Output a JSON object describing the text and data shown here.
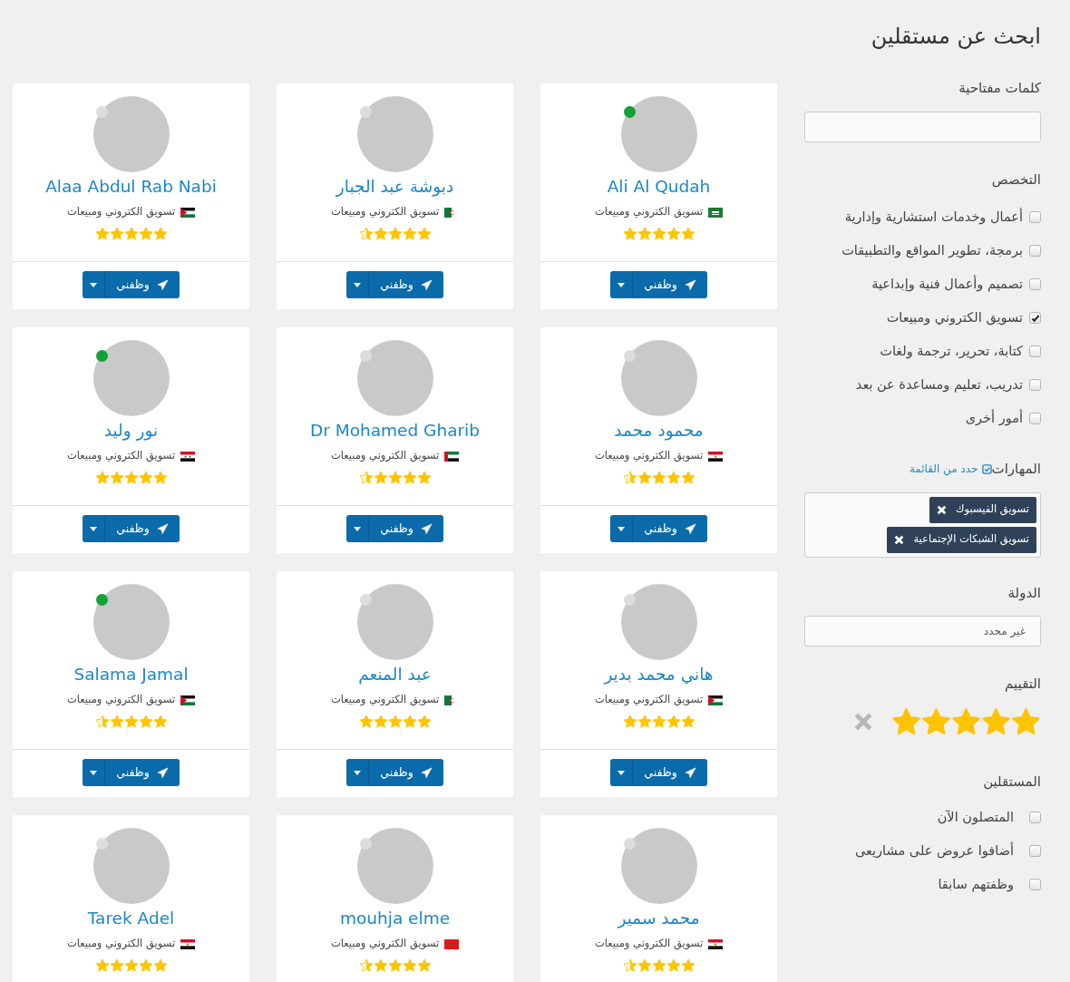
{
  "sidebar": {
    "title": "ابحث عن مستقلين",
    "keywords": {
      "label": "كلمات مفتاحية"
    },
    "specialty": {
      "label": "التخصص",
      "options": [
        {
          "label": "أعمال وخدمات استشارية وإدارية",
          "checked": false
        },
        {
          "label": "برمجة، تطوير المواقع والتطبيقات",
          "checked": false
        },
        {
          "label": "تصميم وأعمال فنية وإبداعية",
          "checked": false
        },
        {
          "label": "تسويق الكتروني ومبيعات",
          "checked": true
        },
        {
          "label": "كتابة، تحرير، ترجمة ولغات",
          "checked": false
        },
        {
          "label": "تدريب، تعليم ومساعدة عن بعد",
          "checked": false
        },
        {
          "label": "أمور أخرى",
          "checked": false
        }
      ]
    },
    "skills": {
      "label": "المهارات",
      "pick_link": "حدد من القائمة",
      "tags": [
        "تسويق الفيسبوك",
        "تسويق الشبكات الإجتماعية"
      ]
    },
    "country": {
      "label": "الدولة",
      "value": "غير محدد"
    },
    "rating": {
      "label": "التقييم",
      "stars": 5
    },
    "freelancers_filter": {
      "label": "المستقلين",
      "options": [
        {
          "label": "المتصلون الآن",
          "checked": false
        },
        {
          "label": "أضافوا عروض على مشاريعى",
          "checked": false
        },
        {
          "label": "وظفتهم سابقا",
          "checked": false
        }
      ]
    }
  },
  "freelancers": [
    {
      "name": "Ali Al Qudah",
      "flag": {
        "kind": "sa"
      },
      "specialty": "تسويق الكتروني ومبيعات",
      "online": true,
      "stars": 5,
      "hire": "وظفني"
    },
    {
      "name": "دبوشة عبد الجبار",
      "flag": {
        "kind": "dz"
      },
      "specialty": "تسويق الكتروني ومبيعات",
      "online": false,
      "stars": 4.5,
      "hire": "وظفني"
    },
    {
      "name": "Alaa Abdul Rab Nabi",
      "flag": {
        "kind": "jo"
      },
      "specialty": "تسويق الكتروني ومبيعات",
      "online": false,
      "stars": 5,
      "hire": "وظفني"
    },
    {
      "name": "محمود محمد",
      "flag": {
        "kind": "eg"
      },
      "specialty": "تسويق الكتروني ومبيعات",
      "online": false,
      "stars": 4.5,
      "hire": "وظفني"
    },
    {
      "name": "Dr Mohamed Gharib",
      "flag": {
        "kind": "ae"
      },
      "specialty": "تسويق الكتروني ومبيعات",
      "online": false,
      "stars": 4.5,
      "hire": "وظفني"
    },
    {
      "name": "نور وليد",
      "flag": {
        "kind": "sy"
      },
      "specialty": "تسويق الكتروني ومبيعات",
      "online": true,
      "stars": 5,
      "hire": "وظفني"
    },
    {
      "name": "هاني محمد بدير",
      "flag": {
        "kind": "jo"
      },
      "specialty": "تسويق الكتروني ومبيعات",
      "online": false,
      "stars": 5,
      "hire": "وظفني"
    },
    {
      "name": "عبد المنعم",
      "flag": {
        "kind": "dz"
      },
      "specialty": "تسويق الكتروني ومبيعات",
      "online": false,
      "stars": 5,
      "hire": "وظفني"
    },
    {
      "name": "Salama Jamal",
      "flag": {
        "kind": "jo"
      },
      "specialty": "تسويق الكتروني ومبيعات",
      "online": true,
      "stars": 4.5,
      "hire": "وظفني"
    },
    {
      "name": "محمد سمير",
      "flag": {
        "kind": "eg"
      },
      "specialty": "تسويق الكتروني ومبيعات",
      "online": false,
      "stars": 4.5
    },
    {
      "name": "mouhja elme",
      "flag": {
        "kind": "ma"
      },
      "specialty": "تسويق الكتروني ومبيعات",
      "online": false,
      "stars": 4.5
    },
    {
      "name": "Tarek Adel",
      "flag": {
        "kind": "eg"
      },
      "specialty": "تسويق الكتروني ومبيعات",
      "online": false,
      "stars": 5
    }
  ]
}
